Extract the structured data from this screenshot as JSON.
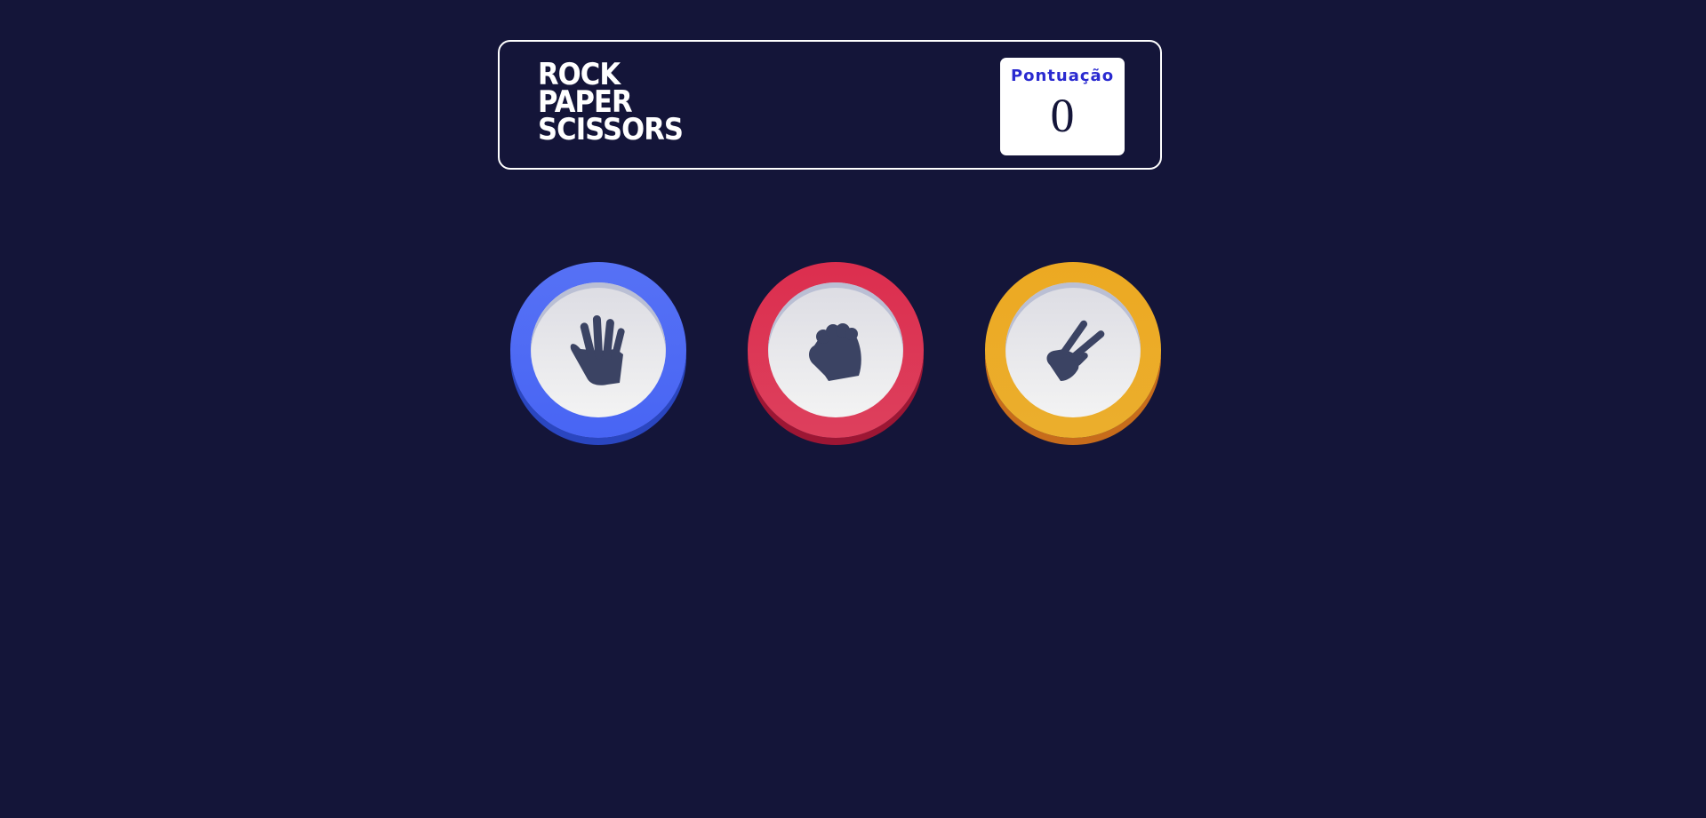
{
  "header": {
    "logo_lines": [
      "ROCK",
      "PAPER",
      "SCISSORS"
    ],
    "score_label": "Pontuação",
    "score_value": "0"
  },
  "choices": [
    {
      "id": "paper",
      "icon": "paper-hand-icon",
      "ring_color": "#4865f4"
    },
    {
      "id": "rock",
      "icon": "rock-fist-icon",
      "ring_color": "#dc2e4e"
    },
    {
      "id": "scissors",
      "icon": "scissors-hand-icon",
      "ring_color": "#eca922"
    }
  ],
  "colors": {
    "background": "#141539",
    "icon": "#3b4363",
    "score_label": "#2a2ad0"
  }
}
